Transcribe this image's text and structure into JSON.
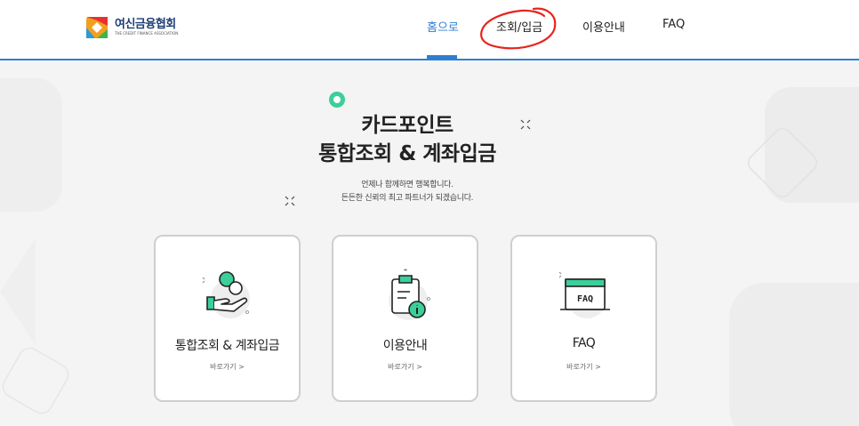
{
  "header": {
    "logo": {
      "title": "여신금융협회",
      "subtitle": "THE CREDIT FINANCE ASSOCIATION",
      "icon": "cfa-logo-icon"
    },
    "nav": [
      {
        "label": "홈으로",
        "active": true
      },
      {
        "label": "조회/입금",
        "active": false
      },
      {
        "label": "이용안내",
        "active": false
      },
      {
        "label": "FAQ",
        "active": false
      }
    ]
  },
  "hero": {
    "title_line1": "카드포인트",
    "title_line2": "통합조회 & 계좌입금",
    "sub_line1": "언제나 함께하면 행복합니다.",
    "sub_line2": "든든한 신뢰의 최고 파트너가 되겠습니다."
  },
  "cards": [
    {
      "title": "통합조회 & 계좌입금",
      "link": "바로가기 >",
      "icon": "coin-hand-icon"
    },
    {
      "title": "이용안내",
      "link": "바로가기 >",
      "icon": "clipboard-info-icon"
    },
    {
      "title": "FAQ",
      "link": "바로가기 >",
      "icon": "faq-window-icon"
    }
  ],
  "colors": {
    "accent": "#2f7fd0",
    "green": "#3ccf9a",
    "annotation_red": "#e8231f",
    "background": "#f4f4f4"
  }
}
